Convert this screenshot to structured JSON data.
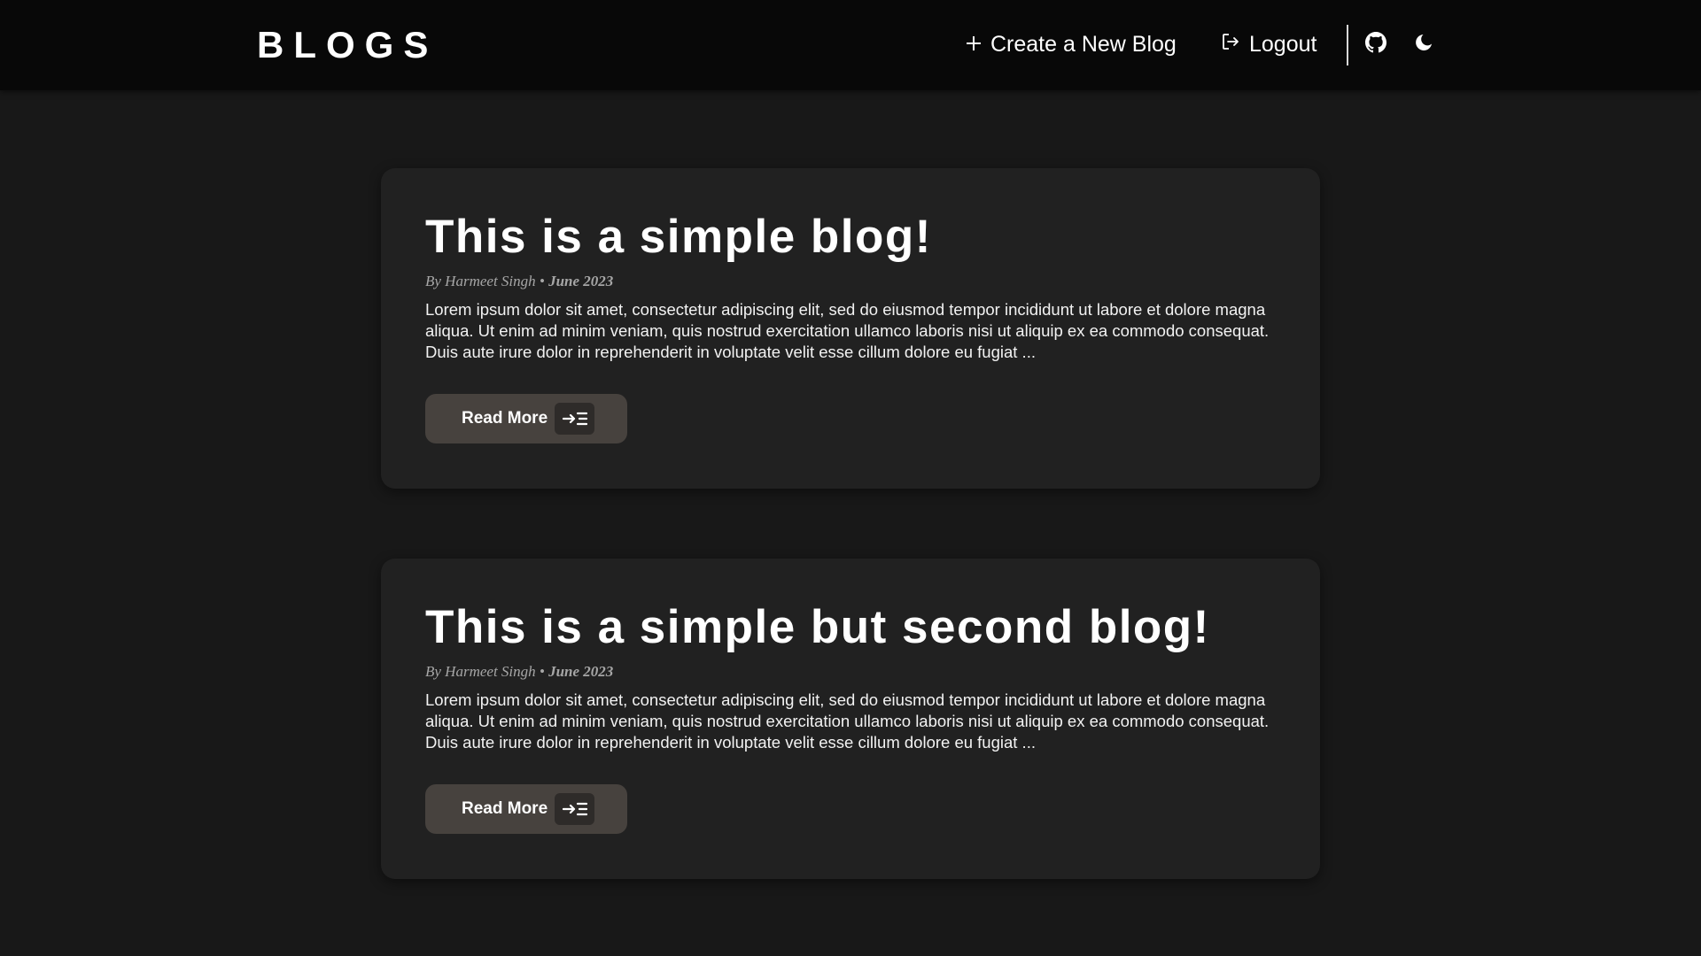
{
  "navbar": {
    "brand": "BLOGS",
    "create_label": "Create a New Blog",
    "create_icon": "plus-icon",
    "logout_label": "Logout",
    "logout_icon": "logout-icon",
    "github_icon": "github-icon",
    "theme_icon": "moon-icon"
  },
  "posts": [
    {
      "title": "This is a simple blog!",
      "author": "By Harmeet Singh",
      "separator": "•",
      "date": "June 2023",
      "excerpt": "Lorem ipsum dolor sit amet, consectetur adipiscing elit, sed do eiusmod tempor incididunt ut labore et dolore magna aliqua. Ut enim ad minim veniam, quis nostrud exercitation ullamco laboris nisi ut aliquip ex ea commodo consequat. Duis aute irure dolor in reprehenderit in voluptate velit esse cillum dolore eu fugiat ...",
      "read_more_label": "Read More",
      "read_more_icon": "arrow-into-list-icon"
    },
    {
      "title": "This is a simple but second blog!",
      "author": "By Harmeet Singh",
      "separator": "•",
      "date": "June 2023",
      "excerpt": "Lorem ipsum dolor sit amet, consectetur adipiscing elit, sed do eiusmod tempor incididunt ut labore et dolore magna aliqua. Ut enim ad minim veniam, quis nostrud exercitation ullamco laboris nisi ut aliquip ex ea commodo consequat. Duis aute irure dolor in reprehenderit in voluptate velit esse cillum dolore eu fugiat ...",
      "read_more_label": "Read More",
      "read_more_icon": "arrow-into-list-icon"
    }
  ],
  "colors": {
    "page_background": "#181818",
    "navbar_background": "#080808",
    "card_background": "#212121",
    "button_background": "#47423e",
    "meta_text": "#a6a6a6"
  }
}
